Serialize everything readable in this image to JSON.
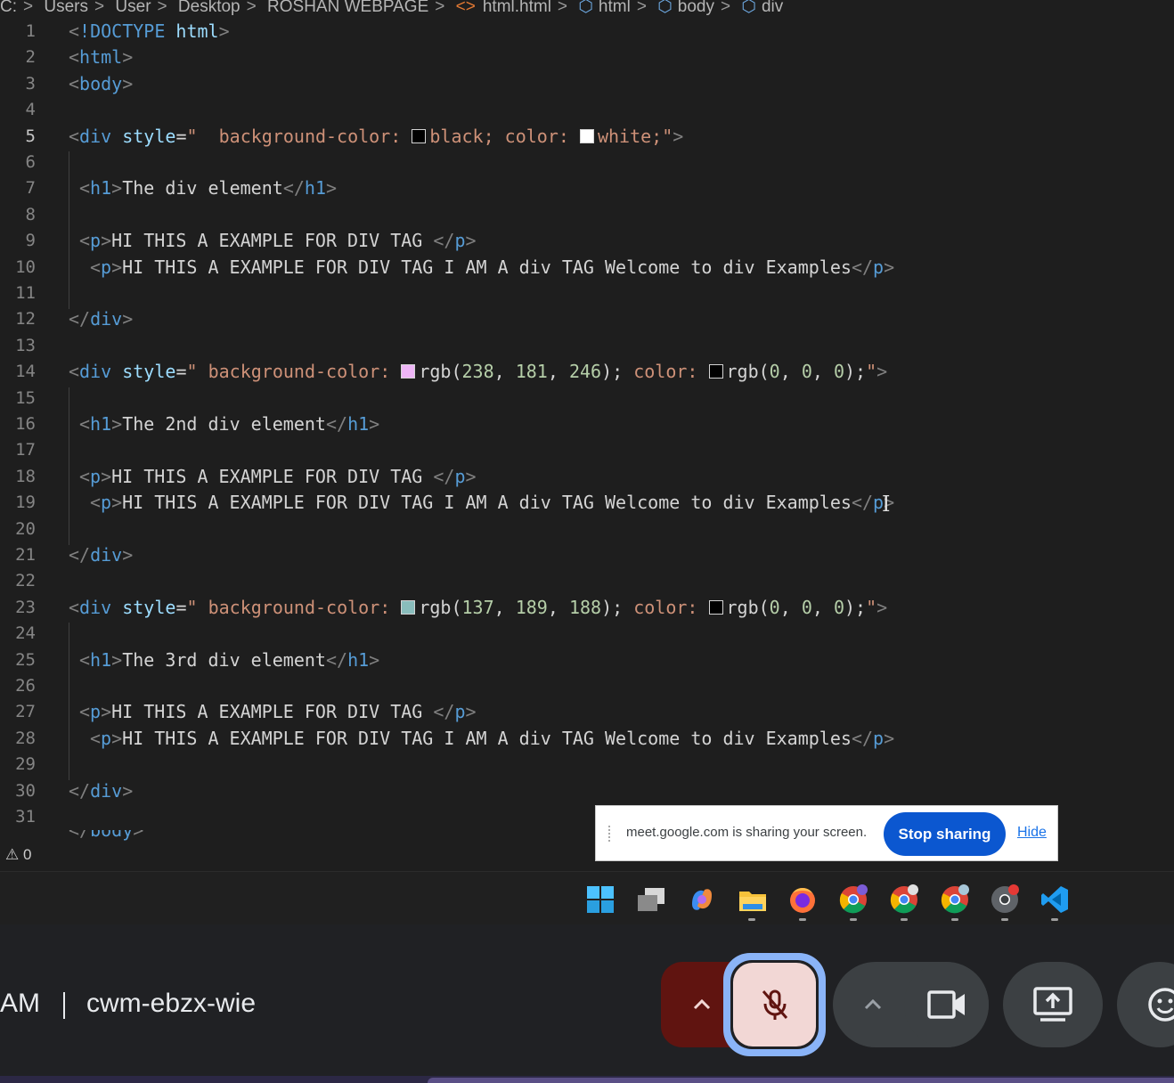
{
  "breadcrumb": {
    "items": [
      "C:",
      "Users",
      "User",
      "Desktop",
      "ROSHAN WEBPAGE",
      "html.html",
      "html",
      "body",
      "div"
    ],
    "separator": ">"
  },
  "editor": {
    "lines": [
      {
        "n": "1"
      },
      {
        "n": "2"
      },
      {
        "n": "3"
      },
      {
        "n": "4"
      },
      {
        "n": "5"
      },
      {
        "n": "6"
      },
      {
        "n": "7"
      },
      {
        "n": "8"
      },
      {
        "n": "9"
      },
      {
        "n": "10"
      },
      {
        "n": "11"
      },
      {
        "n": "12"
      },
      {
        "n": "13"
      },
      {
        "n": "14"
      },
      {
        "n": "15"
      },
      {
        "n": "16"
      },
      {
        "n": "17"
      },
      {
        "n": "18"
      },
      {
        "n": "19"
      },
      {
        "n": "20"
      },
      {
        "n": "21"
      },
      {
        "n": "22"
      },
      {
        "n": "23"
      },
      {
        "n": "24"
      },
      {
        "n": "25"
      },
      {
        "n": "26"
      },
      {
        "n": "27"
      },
      {
        "n": "28"
      },
      {
        "n": "29"
      },
      {
        "n": "30"
      },
      {
        "n": "31"
      }
    ],
    "active_line": "5",
    "code": {
      "doctype": "!DOCTYPE",
      "html_tag": "html",
      "body_tag": "body",
      "div_tag": "div",
      "style_attr": "style",
      "bg_prop": "background-color:",
      "color_prop": "color:",
      "div1": {
        "bg": "black;",
        "color": "white;",
        "bg_swatch": "#000000",
        "color_swatch": "#ffffff",
        "h1": "The div element",
        "p1": "HI THIS A EXAMPLE FOR DIV TAG ",
        "p2": "HI THIS A EXAMPLE FOR DIV TAG I AM A div TAG Welcome to div Examples"
      },
      "div2": {
        "bg_fn": "rgb(",
        "bg_vals": [
          "238",
          "181",
          "246"
        ],
        "color_vals": [
          "0",
          "0",
          "0"
        ],
        "bg_swatch": "#eeb5f6",
        "color_swatch": "#000000",
        "h1": "The 2nd div element",
        "p1": "HI THIS A EXAMPLE FOR DIV TAG ",
        "p2": "HI THIS A EXAMPLE FOR DIV TAG I AM A div TAG Welcome to div Examples"
      },
      "div3": {
        "bg_vals": [
          "137",
          "189",
          "188"
        ],
        "color_vals": [
          "0",
          "0",
          "0"
        ],
        "bg_swatch": "#89bdbc",
        "color_swatch": "#000000",
        "h1": "The 3rd div element",
        "p1": "HI THIS A EXAMPLE FOR DIV TAG ",
        "p2": "HI THIS A EXAMPLE FOR DIV TAG I AM A div TAG Welcome to div Examples"
      }
    }
  },
  "status": {
    "problems": "0",
    "warning_icon": "warning-icon"
  },
  "share_notice": {
    "text": "meet.google.com is sharing your screen.",
    "stop_label": "Stop sharing",
    "hide_label": "Hide"
  },
  "taskbar": {
    "icons": [
      "windows-start-icon",
      "task-view-icon",
      "copilot-icon",
      "file-explorer-icon",
      "firefox-icon",
      "chrome-icon",
      "chrome-profile-icon",
      "chrome-profile-2-icon",
      "chrome-canary-icon",
      "vscode-icon"
    ]
  },
  "meet": {
    "time_suffix": "AM",
    "meeting_code": "cwm-ebzx-wie"
  },
  "colors": {
    "editor_bg": "#1e1e1e",
    "stop_button": "#0b57d0",
    "mic_muted_bg": "#f2d7d5",
    "mic_arrow_bg": "#601410",
    "focus_ring": "#8ab4f8"
  }
}
